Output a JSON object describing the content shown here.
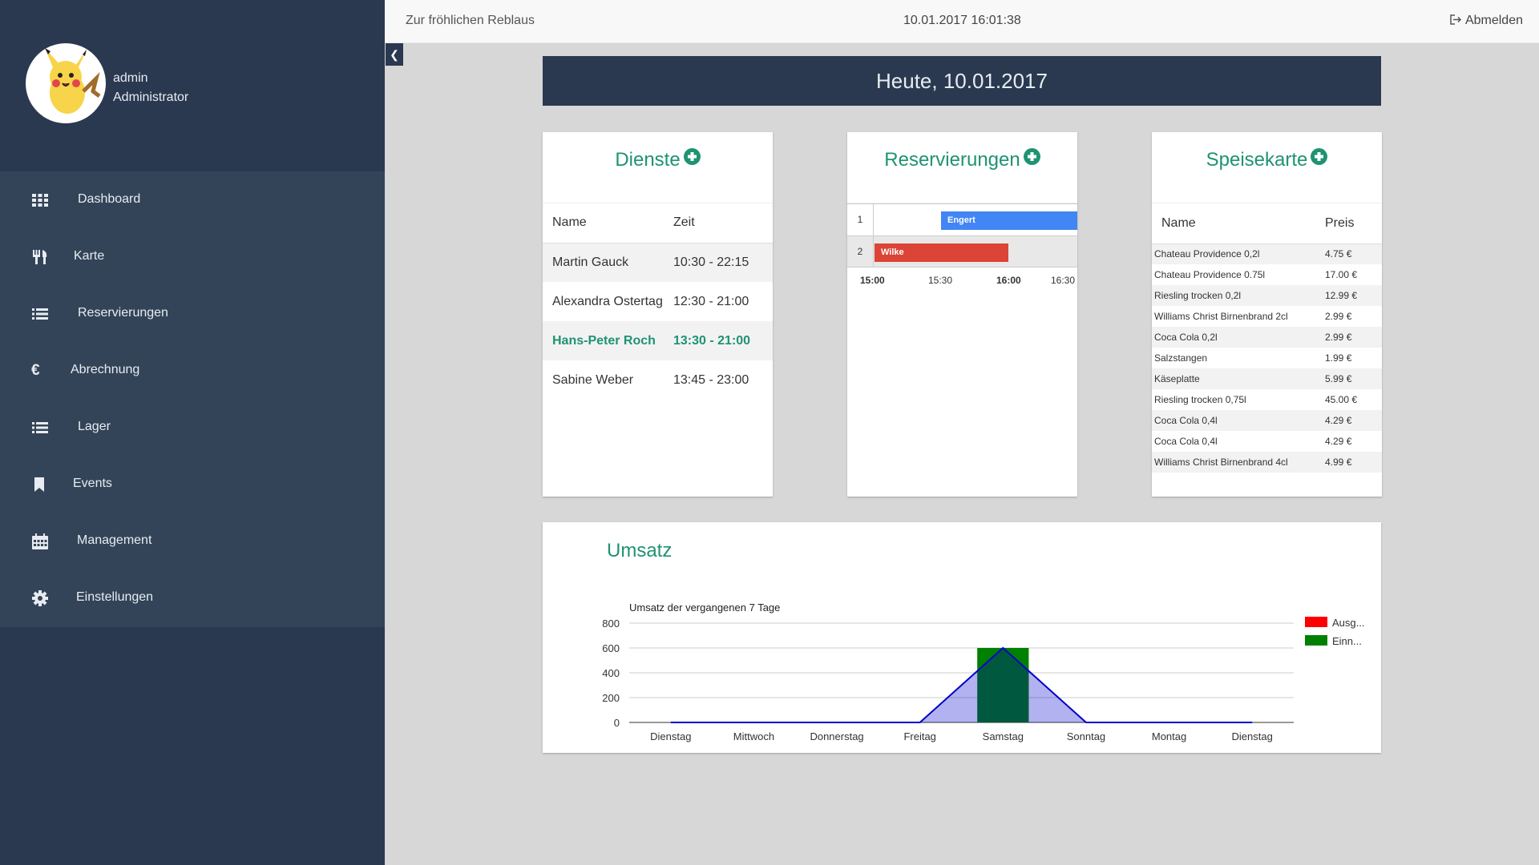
{
  "user": {
    "name": "admin",
    "role": "Administrator"
  },
  "sidebar": {
    "items": [
      {
        "label": "Dashboard",
        "icon": "grid-icon"
      },
      {
        "label": "Karte",
        "icon": "cutlery-icon"
      },
      {
        "label": "Reservierungen",
        "icon": "list-icon"
      },
      {
        "label": "Abrechnung",
        "icon": "euro-icon"
      },
      {
        "label": "Lager",
        "icon": "list-icon"
      },
      {
        "label": "Events",
        "icon": "bookmark-icon"
      },
      {
        "label": "Management",
        "icon": "calendar-icon"
      },
      {
        "label": "Einstellungen",
        "icon": "gear-icon"
      }
    ]
  },
  "topbar": {
    "brand": "Zur fröhlichen Reblaus",
    "datetime": "10.01.2017 16:01:38",
    "logout": "Abmelden"
  },
  "banner": {
    "title": "Heute, 10.01.2017"
  },
  "dienste": {
    "title": "Dienste",
    "headers": {
      "name": "Name",
      "time": "Zeit"
    },
    "rows": [
      {
        "name": "Martin Gauck",
        "time": "10:30 - 22:15"
      },
      {
        "name": "Alexandra Ostertag",
        "time": "12:30 - 21:00"
      },
      {
        "name": "Hans-Peter Roch",
        "time": "13:30 - 21:00"
      },
      {
        "name": "Sabine Weber",
        "time": "13:45 - 23:00"
      }
    ]
  },
  "reservierungen": {
    "title": "Reservierungen",
    "rows": [
      {
        "num": "1",
        "label": "Engert",
        "color": "#4285f4"
      },
      {
        "num": "2",
        "label": "Wilke",
        "color": "#db4437"
      }
    ],
    "ticks": [
      "15:00",
      "15:30",
      "16:00",
      "16:30"
    ]
  },
  "speisekarte": {
    "title": "Speisekarte",
    "headers": {
      "name": "Name",
      "price": "Preis"
    },
    "rows": [
      {
        "name": "Chateau Providence 0,2l",
        "price": "4.75 €"
      },
      {
        "name": "Chateau Providence 0.75l",
        "price": "17.00 €"
      },
      {
        "name": "Riesling trocken 0,2l",
        "price": "12.99 €"
      },
      {
        "name": "Williams Christ Birnenbrand 2cl",
        "price": "2.99 €"
      },
      {
        "name": "Coca Cola 0,2l",
        "price": "2.99 €"
      },
      {
        "name": "Salzstangen",
        "price": "1.99 €"
      },
      {
        "name": "Käseplatte",
        "price": "5.99 €"
      },
      {
        "name": "Riesling trocken 0,75l",
        "price": "45.00 €"
      },
      {
        "name": "Coca Cola 0,4l",
        "price": "4.29 €"
      },
      {
        "name": "Coca Cola 0,4l",
        "price": "4.29 €"
      },
      {
        "name": "Williams Christ Birnenbrand 4cl",
        "price": "4.99 €"
      }
    ]
  },
  "umsatz": {
    "title": "Umsatz"
  },
  "chart_data": {
    "type": "bar",
    "title": "Umsatz der vergangenen 7 Tage",
    "categories": [
      "Dienstag",
      "Mittwoch",
      "Donnerstag",
      "Freitag",
      "Samstag",
      "Sonntag",
      "Montag",
      "Dienstag"
    ],
    "series": [
      {
        "name": "Ausg...",
        "type": "bar",
        "color": "#ff0000",
        "values": [
          0,
          0,
          0,
          0,
          0,
          0,
          0,
          0
        ]
      },
      {
        "name": "Einn...",
        "type": "bar",
        "color": "#008000",
        "values": [
          0,
          0,
          0,
          0,
          600,
          0,
          0,
          0
        ]
      },
      {
        "type": "area",
        "color": "#0000cc",
        "values": [
          0,
          0,
          0,
          0,
          600,
          0,
          0,
          0
        ]
      }
    ],
    "yticks": [
      0,
      200,
      400,
      600,
      800
    ],
    "ylim": [
      0,
      800
    ],
    "legend": "right"
  }
}
